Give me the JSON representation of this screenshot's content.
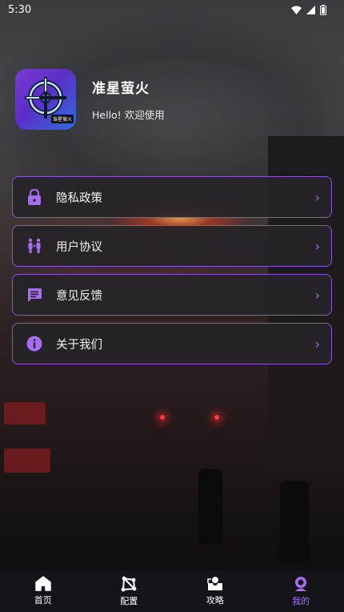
{
  "status_bar": {
    "time": "5:30"
  },
  "profile": {
    "app_name": "准星萤火",
    "greeting": "Hello! 欢迎使用",
    "icon_tag": "准星萤火"
  },
  "menu": {
    "items": [
      {
        "label": "隐私政策",
        "icon": "lock-icon"
      },
      {
        "label": "用户协议",
        "icon": "people-icon"
      },
      {
        "label": "意见反馈",
        "icon": "feedback-icon"
      },
      {
        "label": "关于我们",
        "icon": "info-icon"
      }
    ]
  },
  "tabbar": {
    "tabs": [
      {
        "label": "首页",
        "icon": "home-icon"
      },
      {
        "label": "配置",
        "icon": "config-icon"
      },
      {
        "label": "攻略",
        "icon": "guide-icon"
      },
      {
        "label": "我的",
        "icon": "profile-icon",
        "active": true
      }
    ]
  },
  "colors": {
    "accent": "#a56ef0",
    "border": "#8b55d6",
    "tabbar_bg": "#15131a"
  }
}
